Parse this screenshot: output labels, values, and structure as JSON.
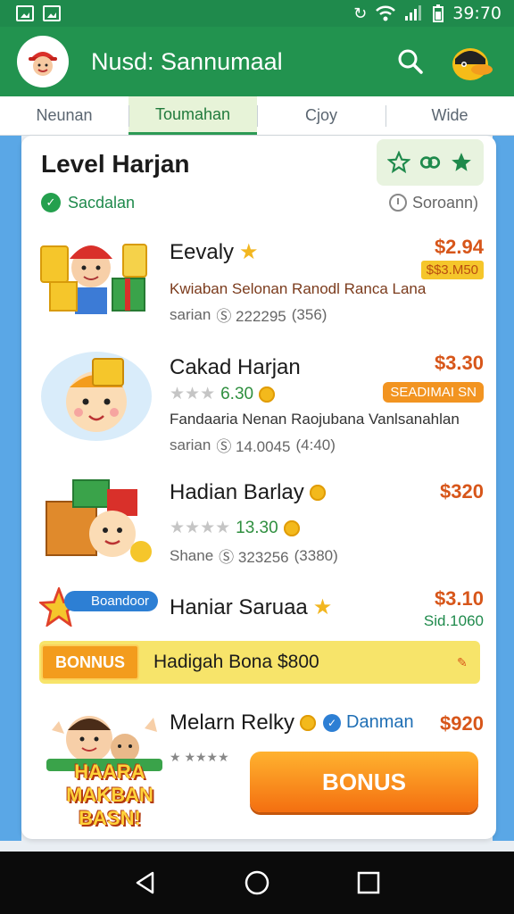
{
  "statusbar": {
    "time": "39:70"
  },
  "appbar": {
    "title": "Nusd: Sannumaal"
  },
  "tabs": [
    {
      "label": "Neunan",
      "active": false
    },
    {
      "label": "Toumahan",
      "active": true
    },
    {
      "label": "Cjoy",
      "active": false
    },
    {
      "label": "Wide",
      "active": false
    }
  ],
  "card": {
    "title": "Level Harjan",
    "sub_left": "Sacdalan",
    "sub_right": "Soroann)"
  },
  "items": [
    {
      "title": "Eevaly",
      "price": "$2.94",
      "tag": "$$3.M50",
      "desc": "Kwiaban Selonan Ranodl Ranca Lana",
      "meta_label": "sarian",
      "meta_value": "Ⓢ 222295",
      "meta_count": "(356)"
    },
    {
      "title": "Cakad Harjan",
      "price": "$3.30",
      "tag": "SEADIMAI SN",
      "rating": "6.30",
      "desc": "Fandaaria Nenan Raojubana Vanlsanahlan",
      "meta_label": "sarian",
      "meta_value": "Ⓢ 14.0045",
      "meta_count": "(4:40)"
    },
    {
      "title": "Hadian Barlay",
      "price": "$320",
      "rating": "13.30",
      "meta_label": "Shane",
      "meta_value": "Ⓢ 323256",
      "meta_count": "(3380)"
    },
    {
      "title": "Haniar Saruaa",
      "badge": "Boandoor",
      "price": "$3.10",
      "price_sub": "Sid.1060"
    }
  ],
  "bonus_banner": {
    "tag": "BONNUS",
    "text": "Hadigah Bona $800"
  },
  "last_item": {
    "title": "Melarn Relky",
    "secondary": "Danman",
    "price": "$920",
    "rating_text": "★ ★★★★",
    "promo": "HAARA MAKBAN BASN!"
  },
  "bonus_button": {
    "label": "BONUS"
  },
  "colors": {
    "primary": "#22934f",
    "accent": "#f39c1d",
    "price": "#d7561a"
  }
}
